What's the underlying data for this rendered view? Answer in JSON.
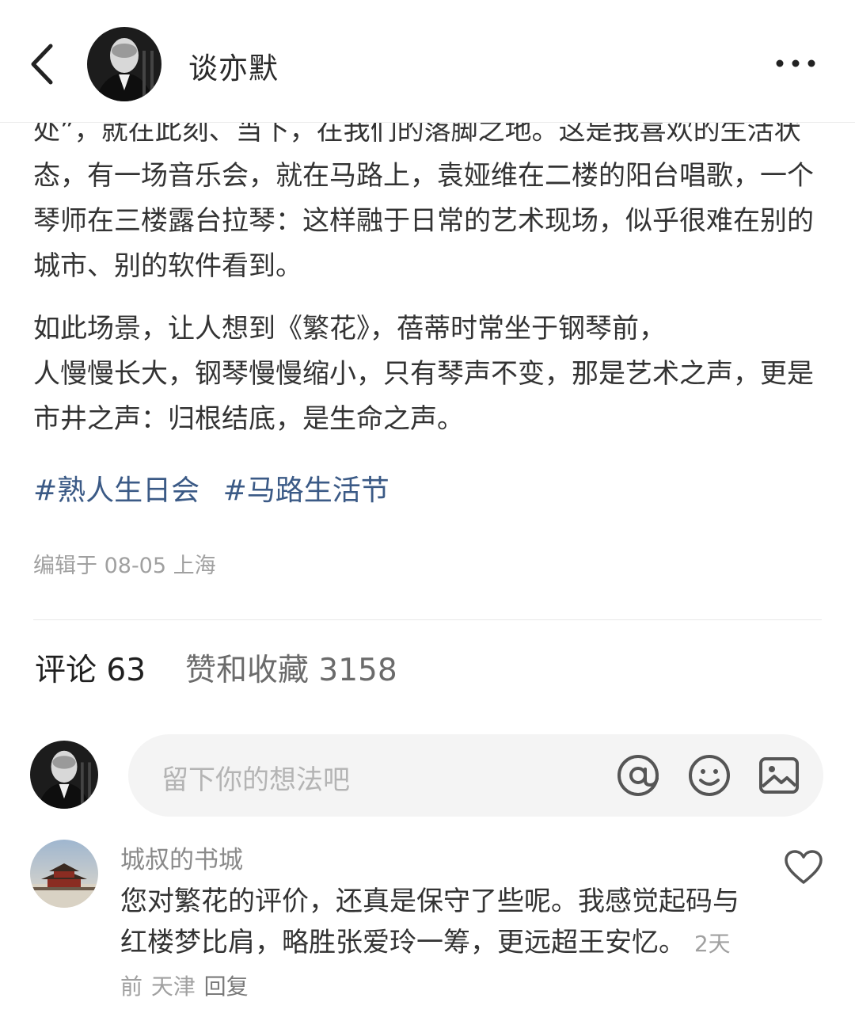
{
  "header": {
    "author_name": "谈亦默"
  },
  "article": {
    "paragraph1": "处”，就在此刻、当下，在我们的落脚之地。这是我喜欢的生活状态，有一场音乐会，就在马路上，袁娅维在二楼的阳台唱歌，一个琴师在三楼露台拉琴：这样融于日常的艺术现场，似乎很难在别的城市、别的软件看到。",
    "paragraph2_line1": "如此场景，让人想到《繁花》，蓓蒂时常坐于钢琴前，",
    "paragraph2_line2": "人慢慢长大，钢琴慢慢缩小，只有琴声不变，那是艺术之声，更是市井之声：归根结底，是生命之声。",
    "tags": [
      "#熟人生日会",
      "#马路生活节"
    ],
    "meta": "编辑于 08-05 上海"
  },
  "tabs": {
    "comments": "评论 63",
    "likes": "赞和收藏 3158"
  },
  "comment_input": {
    "placeholder": "留下你的想法吧",
    "icons": [
      "at-icon",
      "emoji-icon",
      "image-icon"
    ]
  },
  "comments": [
    {
      "user": "城叔的书城",
      "text": "您对繁花的评价，还真是保守了些呢。我感觉起码与红楼梦比肩，略胜张爱玲一筹，更远超王安忆。",
      "time": "2天前",
      "location": "天津",
      "reply": "回复"
    }
  ],
  "colors": {
    "tag_link": "#3b5a86",
    "text": "#333333",
    "muted": "#a0a0a0",
    "input_bg": "#f4f4f4"
  }
}
